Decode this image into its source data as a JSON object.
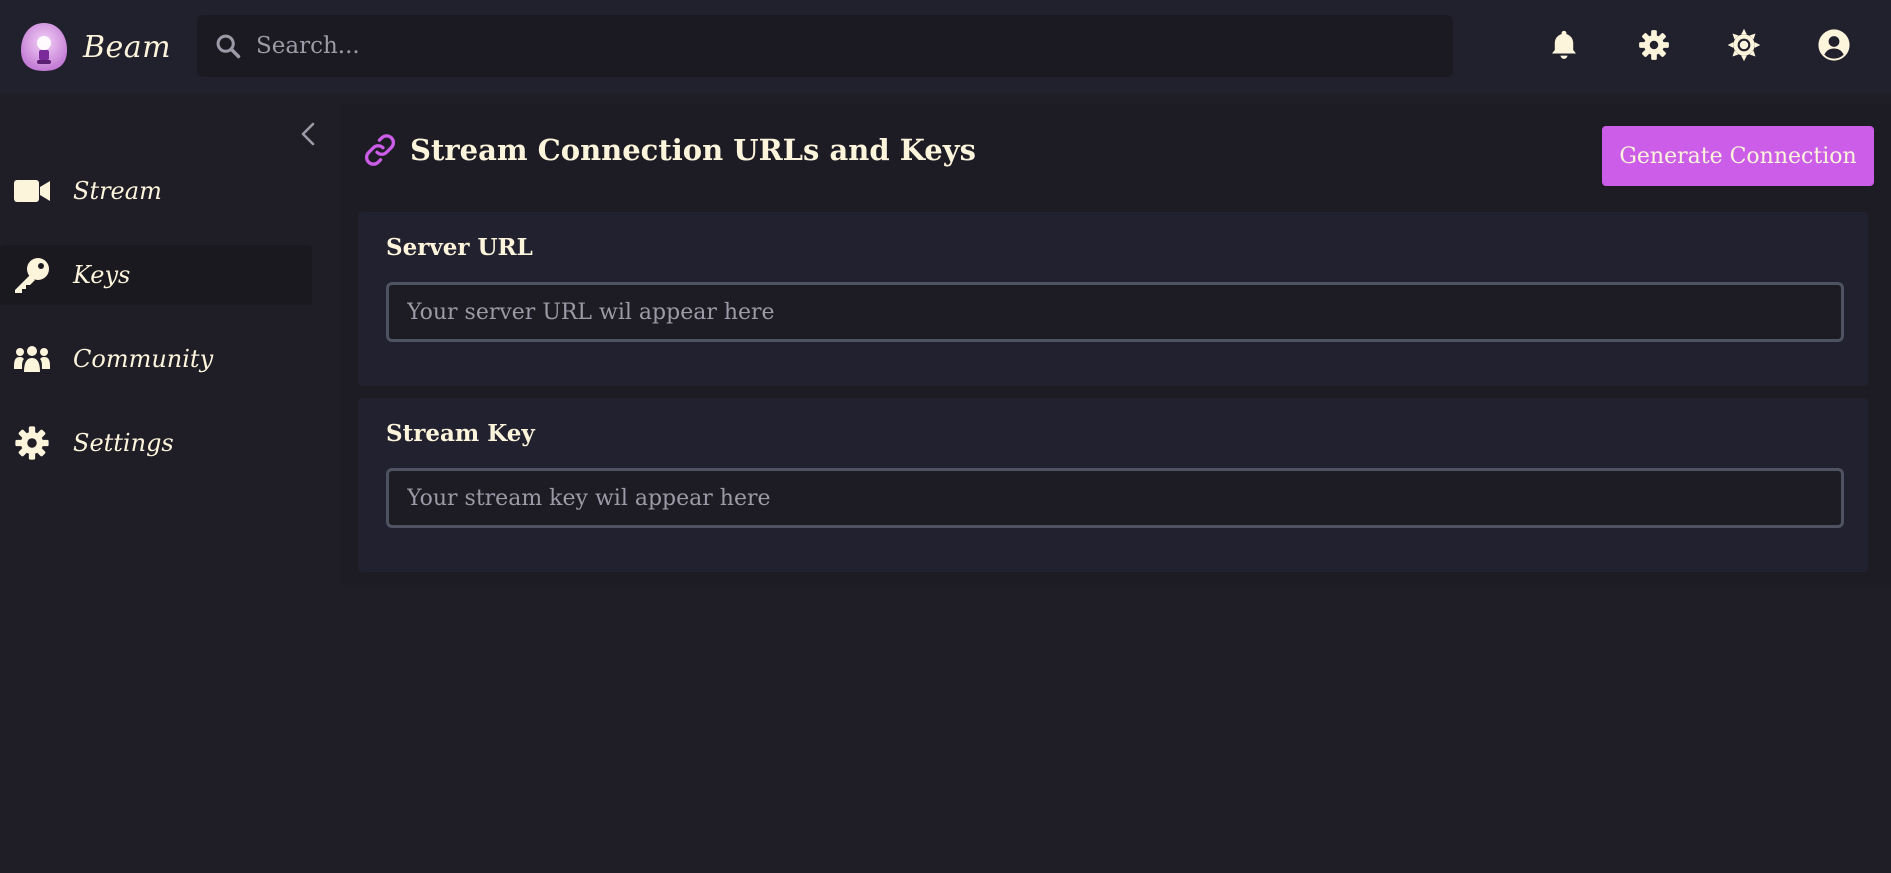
{
  "app": {
    "brand": "Beam"
  },
  "search": {
    "placeholder": "Search..."
  },
  "topbar": {
    "icons": [
      "bell-icon",
      "gear-icon",
      "sun-icon",
      "user-circle-icon"
    ]
  },
  "sidebar": {
    "items": [
      {
        "label": "Stream",
        "icon": "video-camera-icon",
        "active": false
      },
      {
        "label": "Keys",
        "icon": "key-icon",
        "active": true
      },
      {
        "label": "Community",
        "icon": "people-icon",
        "active": false
      },
      {
        "label": "Settings",
        "icon": "gear-icon",
        "active": false
      }
    ]
  },
  "main": {
    "title": "Stream Connection URLs and Keys",
    "generate_label": "Generate Connection",
    "server_url": {
      "label": "Server URL",
      "placeholder": "Your server URL wil appear here",
      "value": ""
    },
    "stream_key": {
      "label": "Stream Key",
      "placeholder": "Your stream key wil appear here",
      "value": ""
    }
  },
  "colors": {
    "accent": "#cc5de8",
    "text": "#fdf4dc",
    "background": "#1f1e26",
    "topbar": "#21202d",
    "card": "#22212f"
  }
}
